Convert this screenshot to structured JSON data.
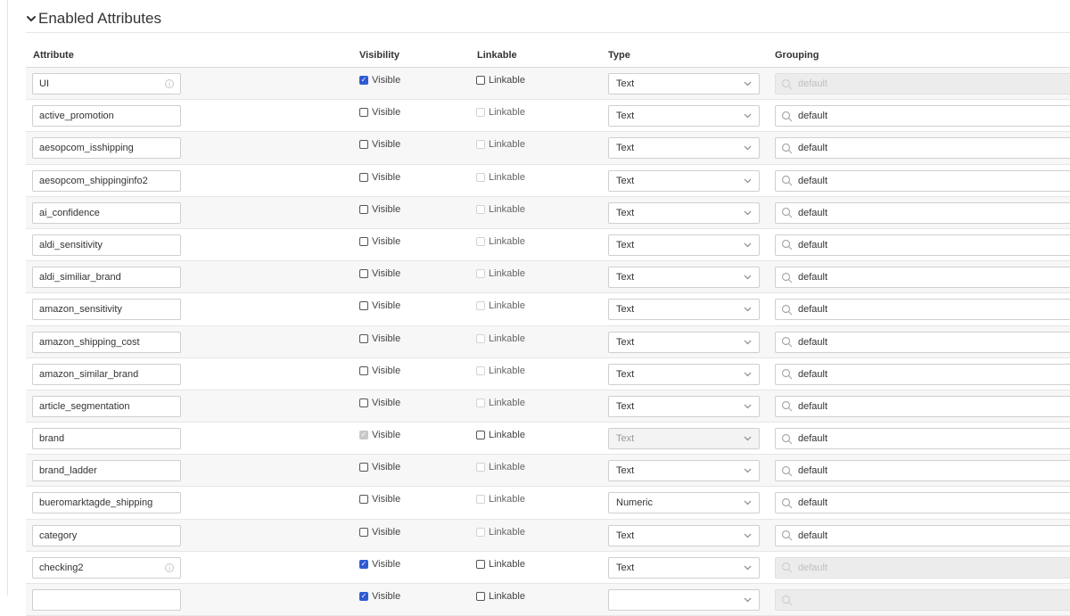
{
  "section": {
    "title": "Enabled Attributes"
  },
  "columns": {
    "attribute": "Attribute",
    "visibility": "Visibility",
    "linkable": "Linkable",
    "type": "Type",
    "grouping": "Grouping"
  },
  "rows": [
    {
      "name": "UI",
      "info": true,
      "visible": "checked",
      "linkable": "unchecked",
      "type": "Text",
      "type_disabled": false,
      "grouping": "default",
      "grouping_disabled": true
    },
    {
      "name": "active_promotion",
      "info": false,
      "visible": "unchecked",
      "linkable": "disabled",
      "type": "Text",
      "type_disabled": false,
      "grouping": "default",
      "grouping_disabled": false
    },
    {
      "name": "aesopcom_isshipping",
      "info": false,
      "visible": "unchecked",
      "linkable": "disabled",
      "type": "Text",
      "type_disabled": false,
      "grouping": "default",
      "grouping_disabled": false
    },
    {
      "name": "aesopcom_shippinginfo2",
      "info": false,
      "visible": "unchecked",
      "linkable": "disabled",
      "type": "Text",
      "type_disabled": false,
      "grouping": "default",
      "grouping_disabled": false
    },
    {
      "name": "ai_confidence",
      "info": false,
      "visible": "unchecked",
      "linkable": "disabled",
      "type": "Text",
      "type_disabled": false,
      "grouping": "default",
      "grouping_disabled": false
    },
    {
      "name": "aldi_sensitivity",
      "info": false,
      "visible": "unchecked",
      "linkable": "disabled",
      "type": "Text",
      "type_disabled": false,
      "grouping": "default",
      "grouping_disabled": false
    },
    {
      "name": "aldi_similiar_brand",
      "info": false,
      "visible": "unchecked",
      "linkable": "disabled",
      "type": "Text",
      "type_disabled": false,
      "grouping": "default",
      "grouping_disabled": false
    },
    {
      "name": "amazon_sensitivity",
      "info": false,
      "visible": "unchecked",
      "linkable": "disabled",
      "type": "Text",
      "type_disabled": false,
      "grouping": "default",
      "grouping_disabled": false
    },
    {
      "name": "amazon_shipping_cost",
      "info": false,
      "visible": "unchecked",
      "linkable": "disabled",
      "type": "Text",
      "type_disabled": false,
      "grouping": "default",
      "grouping_disabled": false
    },
    {
      "name": "amazon_similar_brand",
      "info": false,
      "visible": "unchecked",
      "linkable": "disabled",
      "type": "Text",
      "type_disabled": false,
      "grouping": "default",
      "grouping_disabled": false
    },
    {
      "name": "article_segmentation",
      "info": false,
      "visible": "unchecked",
      "linkable": "disabled",
      "type": "Text",
      "type_disabled": false,
      "grouping": "default",
      "grouping_disabled": false
    },
    {
      "name": "brand",
      "info": false,
      "visible": "checked-disabled",
      "linkable": "unchecked",
      "type": "Text",
      "type_disabled": true,
      "grouping": "default",
      "grouping_disabled": false
    },
    {
      "name": "brand_ladder",
      "info": false,
      "visible": "unchecked",
      "linkable": "disabled",
      "type": "Text",
      "type_disabled": false,
      "grouping": "default",
      "grouping_disabled": false
    },
    {
      "name": "bueromarktagde_shipping",
      "info": false,
      "visible": "unchecked",
      "linkable": "disabled",
      "type": "Numeric",
      "type_disabled": false,
      "grouping": "default",
      "grouping_disabled": false
    },
    {
      "name": "category",
      "info": false,
      "visible": "unchecked",
      "linkable": "disabled",
      "type": "Text",
      "type_disabled": false,
      "grouping": "default",
      "grouping_disabled": false
    },
    {
      "name": "checking2",
      "info": true,
      "visible": "checked",
      "linkable": "unchecked",
      "type": "Text",
      "type_disabled": false,
      "grouping": "default",
      "grouping_disabled": true
    },
    {
      "name": "",
      "info": false,
      "visible": "checked",
      "linkable": "unchecked",
      "type": "",
      "type_disabled": false,
      "grouping": "",
      "grouping_disabled": true
    }
  ],
  "labels": {
    "visible": "Visible",
    "linkable": "Linkable"
  }
}
